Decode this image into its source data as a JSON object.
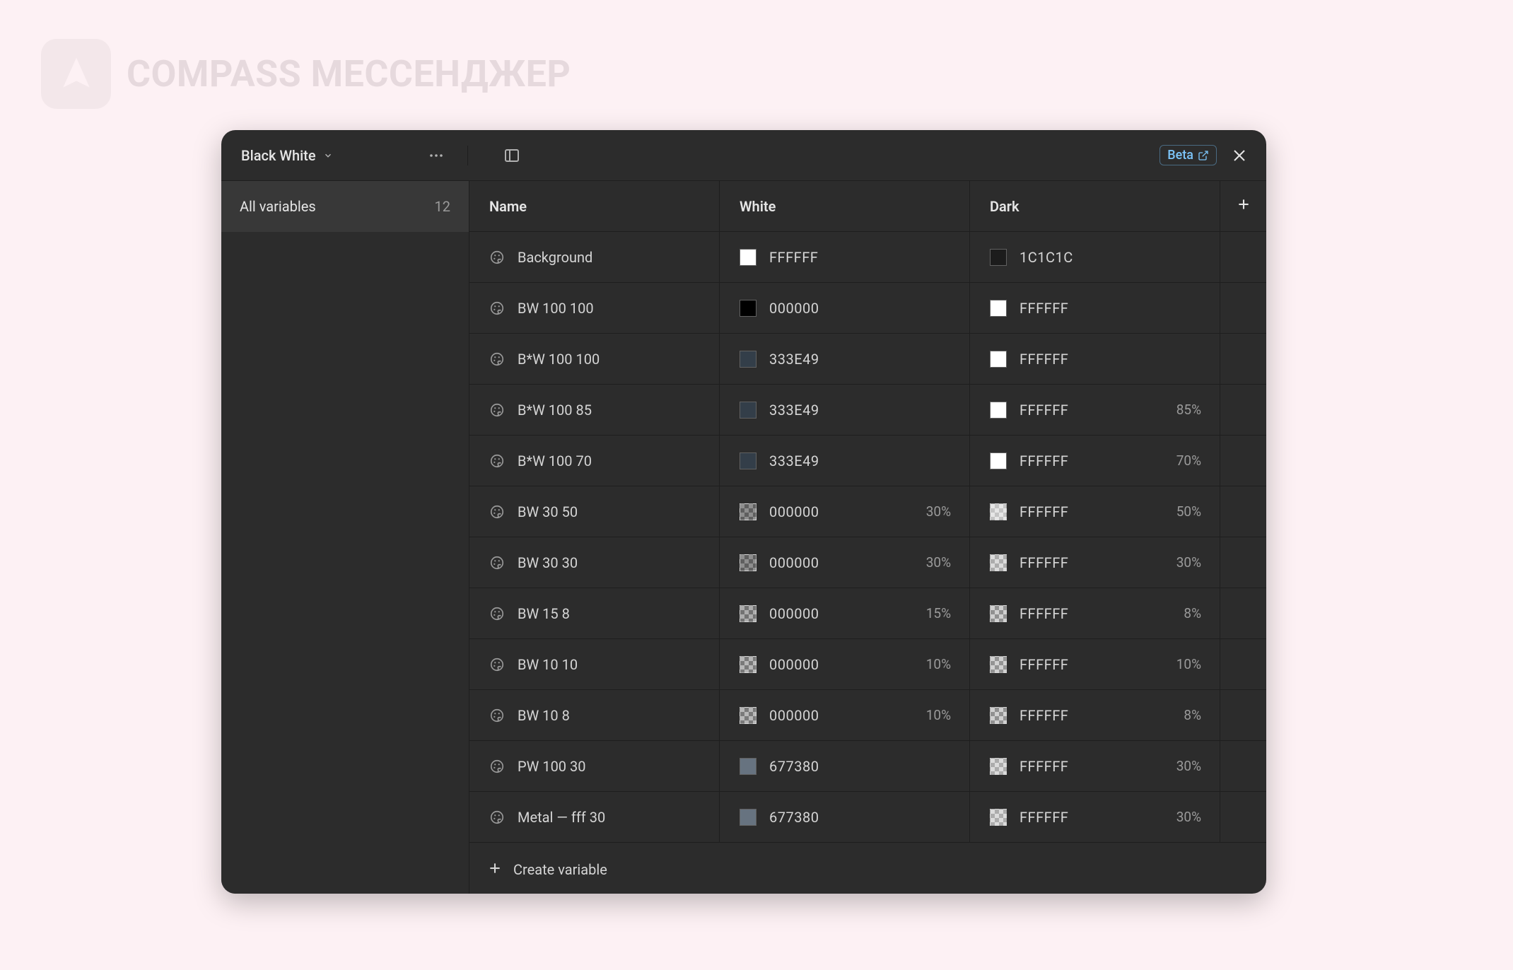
{
  "brand": {
    "text": "COMPASS МЕССЕНДЖЕР"
  },
  "panel": {
    "collection_name": "Black White",
    "beta_label": "Beta",
    "sidebar": {
      "all_variables_label": "All variables",
      "count": "12"
    },
    "columns": {
      "name": "Name",
      "mode1": "White",
      "mode2": "Dark"
    },
    "create_label": "Create variable",
    "variables": [
      {
        "name": "Background",
        "mode1": {
          "hex": "FFFFFF",
          "color": "#FFFFFF",
          "opacity": null,
          "checker": false
        },
        "mode2": {
          "hex": "1C1C1C",
          "color": "#1C1C1C",
          "opacity": null,
          "checker": false
        }
      },
      {
        "name": "BW 100 100",
        "mode1": {
          "hex": "000000",
          "color": "#000000",
          "opacity": null,
          "checker": false
        },
        "mode2": {
          "hex": "FFFFFF",
          "color": "#FFFFFF",
          "opacity": null,
          "checker": false
        }
      },
      {
        "name": "B*W 100 100",
        "mode1": {
          "hex": "333E49",
          "color": "#333E49",
          "opacity": null,
          "checker": false
        },
        "mode2": {
          "hex": "FFFFFF",
          "color": "#FFFFFF",
          "opacity": null,
          "checker": false
        }
      },
      {
        "name": "B*W 100 85",
        "mode1": {
          "hex": "333E49",
          "color": "#333E49",
          "opacity": null,
          "checker": false
        },
        "mode2": {
          "hex": "FFFFFF",
          "color": "#FFFFFF",
          "opacity": "85%",
          "checker": false
        }
      },
      {
        "name": "B*W 100 70",
        "mode1": {
          "hex": "333E49",
          "color": "#333E49",
          "opacity": null,
          "checker": false
        },
        "mode2": {
          "hex": "FFFFFF",
          "color": "#FFFFFF",
          "opacity": "70%",
          "checker": false
        }
      },
      {
        "name": "BW 30 50",
        "mode1": {
          "hex": "000000",
          "color": "rgba(0,0,0,0.30)",
          "opacity": "30%",
          "checker": true
        },
        "mode2": {
          "hex": "FFFFFF",
          "color": "rgba(255,255,255,0.50)",
          "opacity": "50%",
          "checker": true
        }
      },
      {
        "name": "BW 30 30",
        "mode1": {
          "hex": "000000",
          "color": "rgba(0,0,0,0.30)",
          "opacity": "30%",
          "checker": true
        },
        "mode2": {
          "hex": "FFFFFF",
          "color": "rgba(255,255,255,0.30)",
          "opacity": "30%",
          "checker": true
        }
      },
      {
        "name": "BW 15 8",
        "mode1": {
          "hex": "000000",
          "color": "rgba(0,0,0,0.15)",
          "opacity": "15%",
          "checker": true
        },
        "mode2": {
          "hex": "FFFFFF",
          "color": "rgba(255,255,255,0.08)",
          "opacity": "8%",
          "checker": true
        }
      },
      {
        "name": "BW 10 10",
        "mode1": {
          "hex": "000000",
          "color": "rgba(0,0,0,0.10)",
          "opacity": "10%",
          "checker": true
        },
        "mode2": {
          "hex": "FFFFFF",
          "color": "rgba(255,255,255,0.10)",
          "opacity": "10%",
          "checker": true
        }
      },
      {
        "name": "BW 10 8",
        "mode1": {
          "hex": "000000",
          "color": "rgba(0,0,0,0.10)",
          "opacity": "10%",
          "checker": true
        },
        "mode2": {
          "hex": "FFFFFF",
          "color": "rgba(255,255,255,0.08)",
          "opacity": "8%",
          "checker": true
        }
      },
      {
        "name": "PW 100 30",
        "mode1": {
          "hex": "677380",
          "color": "#677380",
          "opacity": null,
          "checker": false
        },
        "mode2": {
          "hex": "FFFFFF",
          "color": "rgba(255,255,255,0.30)",
          "opacity": "30%",
          "checker": true
        }
      },
      {
        "name": "Metal — fff 30",
        "mode1": {
          "hex": "677380",
          "color": "#677380",
          "opacity": null,
          "checker": false
        },
        "mode2": {
          "hex": "FFFFFF",
          "color": "rgba(255,255,255,0.30)",
          "opacity": "30%",
          "checker": true
        }
      }
    ]
  }
}
